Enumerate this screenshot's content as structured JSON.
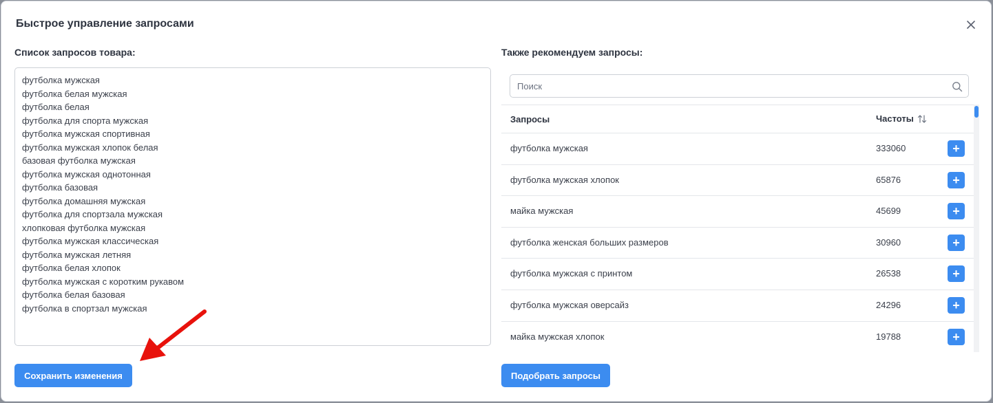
{
  "modal": {
    "title": "Быстрое управление запросами",
    "close_icon": "close-icon"
  },
  "left": {
    "label": "Список запросов товара:",
    "queries": [
      "футболка мужская",
      "футболка белая мужская",
      "футболка белая",
      "футболка для спорта мужская",
      "футболка мужская спортивная",
      "футболка мужская хлопок белая",
      "базовая футболка мужская",
      "футболка мужская однотонная",
      "футболка базовая",
      "футболка домашняя мужская",
      "футболка для спортзала мужская",
      "хлопковая футболка мужская",
      "футболка мужская классическая",
      "футболка мужская летняя",
      "футболка белая хлопок",
      "футболка мужская с коротким рукавом",
      "футболка белая базовая",
      "футболка в спортзал мужская"
    ],
    "save_label": "Сохранить изменения"
  },
  "right": {
    "label": "Также рекомендуем запросы:",
    "search_placeholder": "Поиск",
    "table": {
      "col_query": "Запросы",
      "col_freq": "Частоты",
      "rows": [
        {
          "query": "футболка мужская",
          "freq": "333060"
        },
        {
          "query": "футболка мужская хлопок",
          "freq": "65876"
        },
        {
          "query": "майка мужская",
          "freq": "45699"
        },
        {
          "query": "футболка женская больших размеров",
          "freq": "30960"
        },
        {
          "query": "футболка мужская с принтом",
          "freq": "26538"
        },
        {
          "query": "футболка мужская оверсайз",
          "freq": "24296"
        },
        {
          "query": "майка мужская хлопок",
          "freq": "19788"
        }
      ],
      "add_label": "+"
    },
    "pick_label": "Подобрать запросы"
  },
  "colors": {
    "accent": "#3c8cf0",
    "annotation_arrow": "#e8120c"
  }
}
